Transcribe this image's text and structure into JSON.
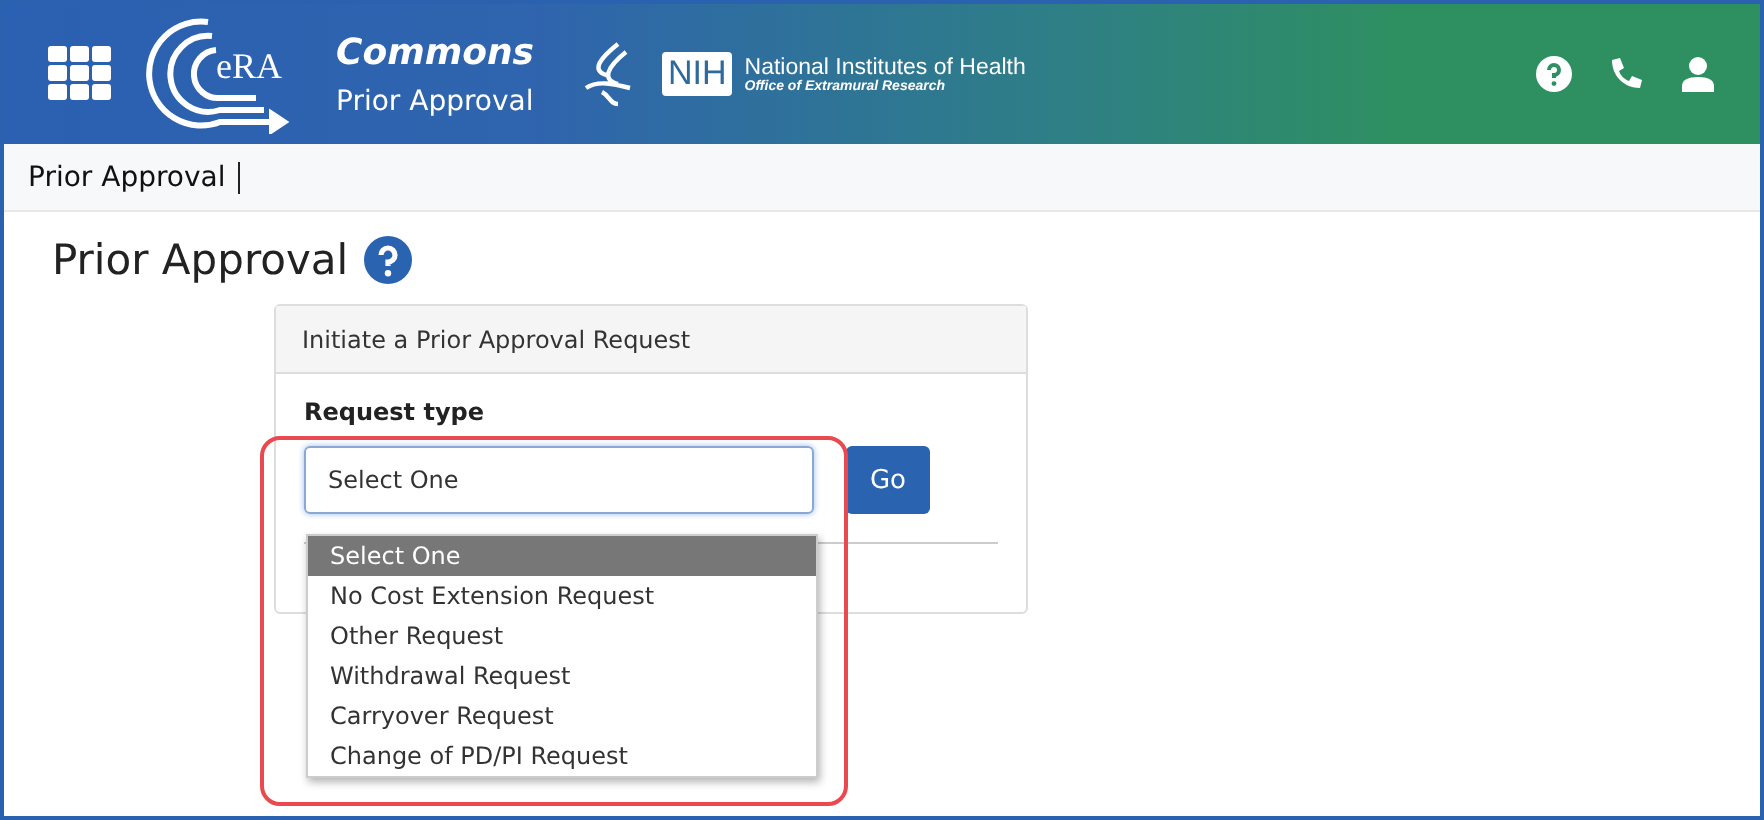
{
  "header": {
    "logo_text": "eRA",
    "app_name": "Commons",
    "app_subtitle": "Prior Approval",
    "nih_mark": "NIH",
    "nih_name": "National Institutes of Health",
    "nih_office": "Office of Extramural Research"
  },
  "breadcrumb": "Prior Approval",
  "page_title": "Prior Approval",
  "card": {
    "title": "Initiate a Prior Approval Request",
    "field_label": "Request type",
    "select_value": "Select One",
    "button": "Go",
    "options": [
      {
        "label": "Select One",
        "selected": true
      },
      {
        "label": "No Cost Extension Request",
        "selected": false
      },
      {
        "label": "Other Request",
        "selected": false
      },
      {
        "label": "Withdrawal Request",
        "selected": false
      },
      {
        "label": "Carryover Request",
        "selected": false
      },
      {
        "label": "Change of PD/PI Request",
        "selected": false
      }
    ]
  }
}
